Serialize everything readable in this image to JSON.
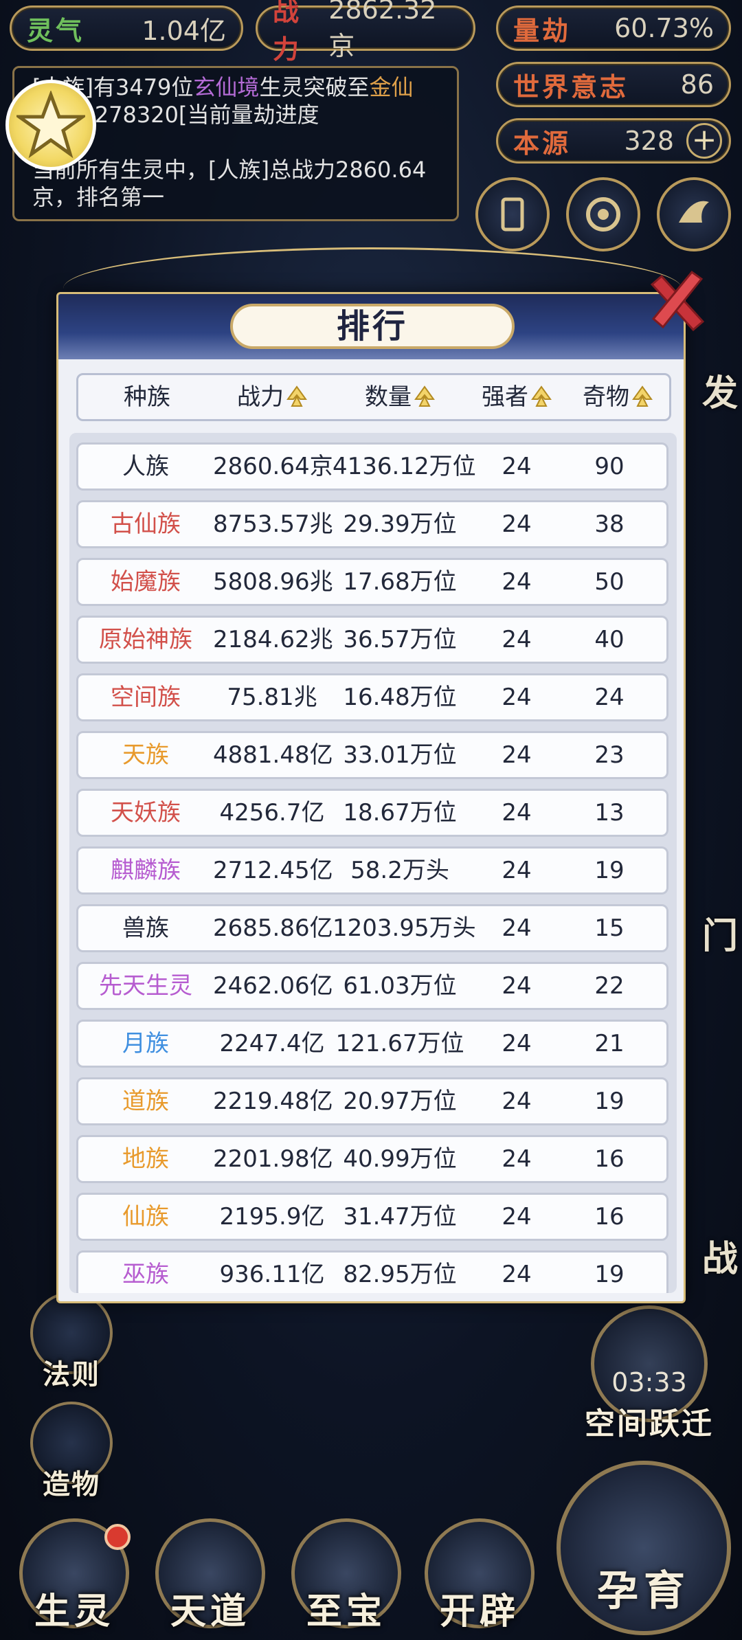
{
  "top_stats": {
    "lingqi": {
      "label": "灵气",
      "value": "1.04亿"
    },
    "zhanli": {
      "label": "战力",
      "value": "2862.32京"
    },
    "liangjie": {
      "label": "量劫",
      "value": "60.73%"
    },
    "shijie_yizhi": {
      "label": "世界意志",
      "value": "86"
    },
    "benyuan": {
      "label": "本源",
      "value": "328",
      "plus": "+"
    }
  },
  "log": {
    "line1_prefix": "[人族]有3479位",
    "line1_highlight": "玄仙境",
    "line1_mid": "生灵突破至",
    "line1_gold": "金仙",
    "line2": "气运+278320[当前量劫进度",
    "line3": "%]",
    "line4": "当前所有生灵中，[人族]总战力2860.64",
    "line5": "京，排名第一"
  },
  "panel": {
    "title": "排行",
    "columns": [
      "种族",
      "战力",
      "数量",
      "强者",
      "奇物"
    ],
    "rows": [
      {
        "race": "人族",
        "power": "2860.64京",
        "count": "4136.12万位",
        "strong": "24",
        "treasure": "90",
        "color": "#22283a"
      },
      {
        "race": "古仙族",
        "power": "8753.57兆",
        "count": "29.39万位",
        "strong": "24",
        "treasure": "38",
        "color": "#d2504a"
      },
      {
        "race": "始魔族",
        "power": "5808.96兆",
        "count": "17.68万位",
        "strong": "24",
        "treasure": "50",
        "color": "#d2504a"
      },
      {
        "race": "原始神族",
        "power": "2184.62兆",
        "count": "36.57万位",
        "strong": "24",
        "treasure": "40",
        "color": "#d2504a"
      },
      {
        "race": "空间族",
        "power": "75.81兆",
        "count": "16.48万位",
        "strong": "24",
        "treasure": "24",
        "color": "#d2504a"
      },
      {
        "race": "天族",
        "power": "4881.48亿",
        "count": "33.01万位",
        "strong": "24",
        "treasure": "23",
        "color": "#e89a2c"
      },
      {
        "race": "天妖族",
        "power": "4256.7亿",
        "count": "18.67万位",
        "strong": "24",
        "treasure": "13",
        "color": "#d2504a"
      },
      {
        "race": "麒麟族",
        "power": "2712.45亿",
        "count": "58.2万头",
        "strong": "24",
        "treasure": "19",
        "color": "#b65cd0"
      },
      {
        "race": "兽族",
        "power": "2685.86亿",
        "count": "1203.95万头",
        "strong": "24",
        "treasure": "15",
        "color": "#22283a"
      },
      {
        "race": "先天生灵",
        "power": "2462.06亿",
        "count": "61.03万位",
        "strong": "24",
        "treasure": "22",
        "color": "#b65cd0"
      },
      {
        "race": "月族",
        "power": "2247.4亿",
        "count": "121.67万位",
        "strong": "24",
        "treasure": "21",
        "color": "#3f8fe0"
      },
      {
        "race": "道族",
        "power": "2219.48亿",
        "count": "20.97万位",
        "strong": "24",
        "treasure": "19",
        "color": "#e89a2c"
      },
      {
        "race": "地族",
        "power": "2201.98亿",
        "count": "40.99万位",
        "strong": "24",
        "treasure": "16",
        "color": "#e89a2c"
      },
      {
        "race": "仙族",
        "power": "2195.9亿",
        "count": "31.47万位",
        "strong": "24",
        "treasure": "16",
        "color": "#e89a2c"
      },
      {
        "race": "巫族",
        "power": "936.11亿",
        "count": "82.95万位",
        "strong": "24",
        "treasure": "19",
        "color": "#b65cd0"
      }
    ]
  },
  "side": {
    "faze": "法则",
    "zaowu": "造物",
    "peek_right_1": "发",
    "peek_right_2": "门",
    "peek_right_3": "战"
  },
  "timer": {
    "time": "03:33",
    "label": "空间跃迁"
  },
  "bottom_nav": [
    "生灵",
    "天道",
    "至宝",
    "开辟"
  ],
  "yunyu": "孕育"
}
